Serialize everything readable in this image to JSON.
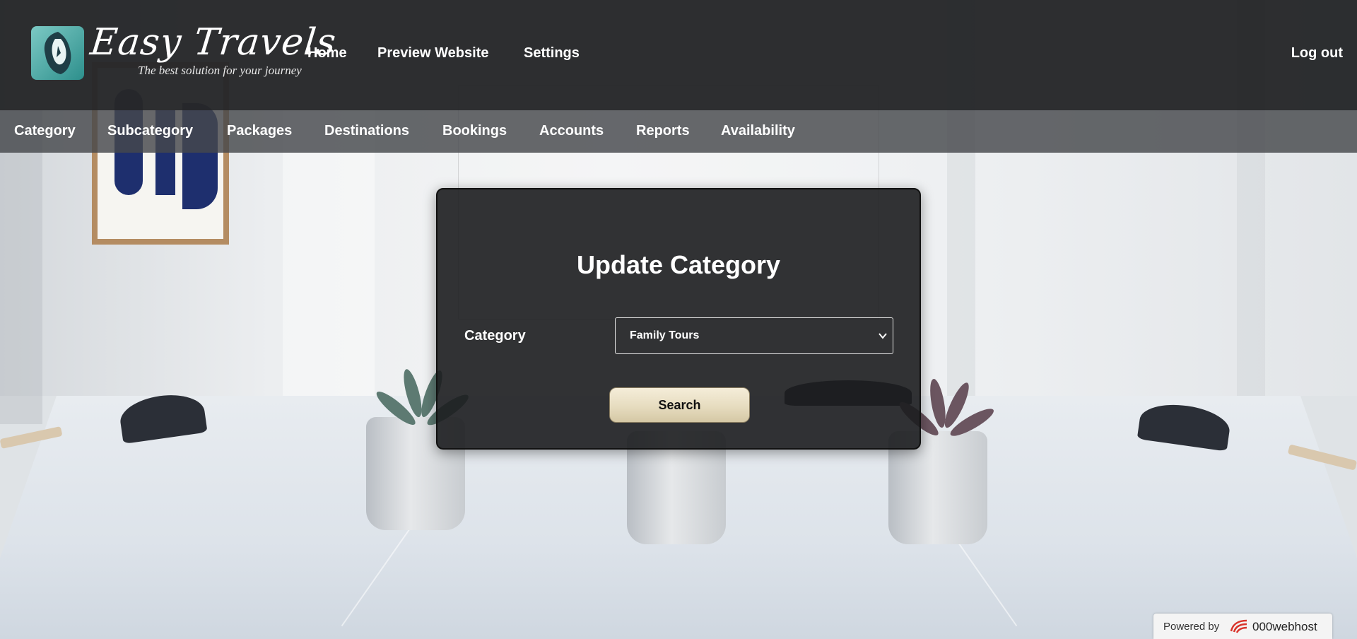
{
  "brand": {
    "name": "Easy Travels",
    "tagline": "The best solution for your journey",
    "logo_icon": "lion-head-icon"
  },
  "top_nav": {
    "items": [
      {
        "label": "Home"
      },
      {
        "label": "Preview Website"
      },
      {
        "label": "Settings"
      }
    ],
    "logout_label": "Log out"
  },
  "sub_nav": {
    "items": [
      {
        "label": "Category"
      },
      {
        "label": "Subcategory"
      },
      {
        "label": "Packages"
      },
      {
        "label": "Destinations"
      },
      {
        "label": "Bookings"
      },
      {
        "label": "Accounts"
      },
      {
        "label": "Reports"
      },
      {
        "label": "Availability"
      }
    ]
  },
  "form": {
    "title": "Update Category",
    "category_label": "Category",
    "category_selected": "Family Tours",
    "search_label": "Search"
  },
  "footer": {
    "powered_by": "Powered by",
    "host_name": "000webhost"
  },
  "colors": {
    "header_bg": "#262729",
    "subnav_bg": "#46484c",
    "panel_bg": "#1c1d1f",
    "button_bg": "#e6dcbf"
  }
}
